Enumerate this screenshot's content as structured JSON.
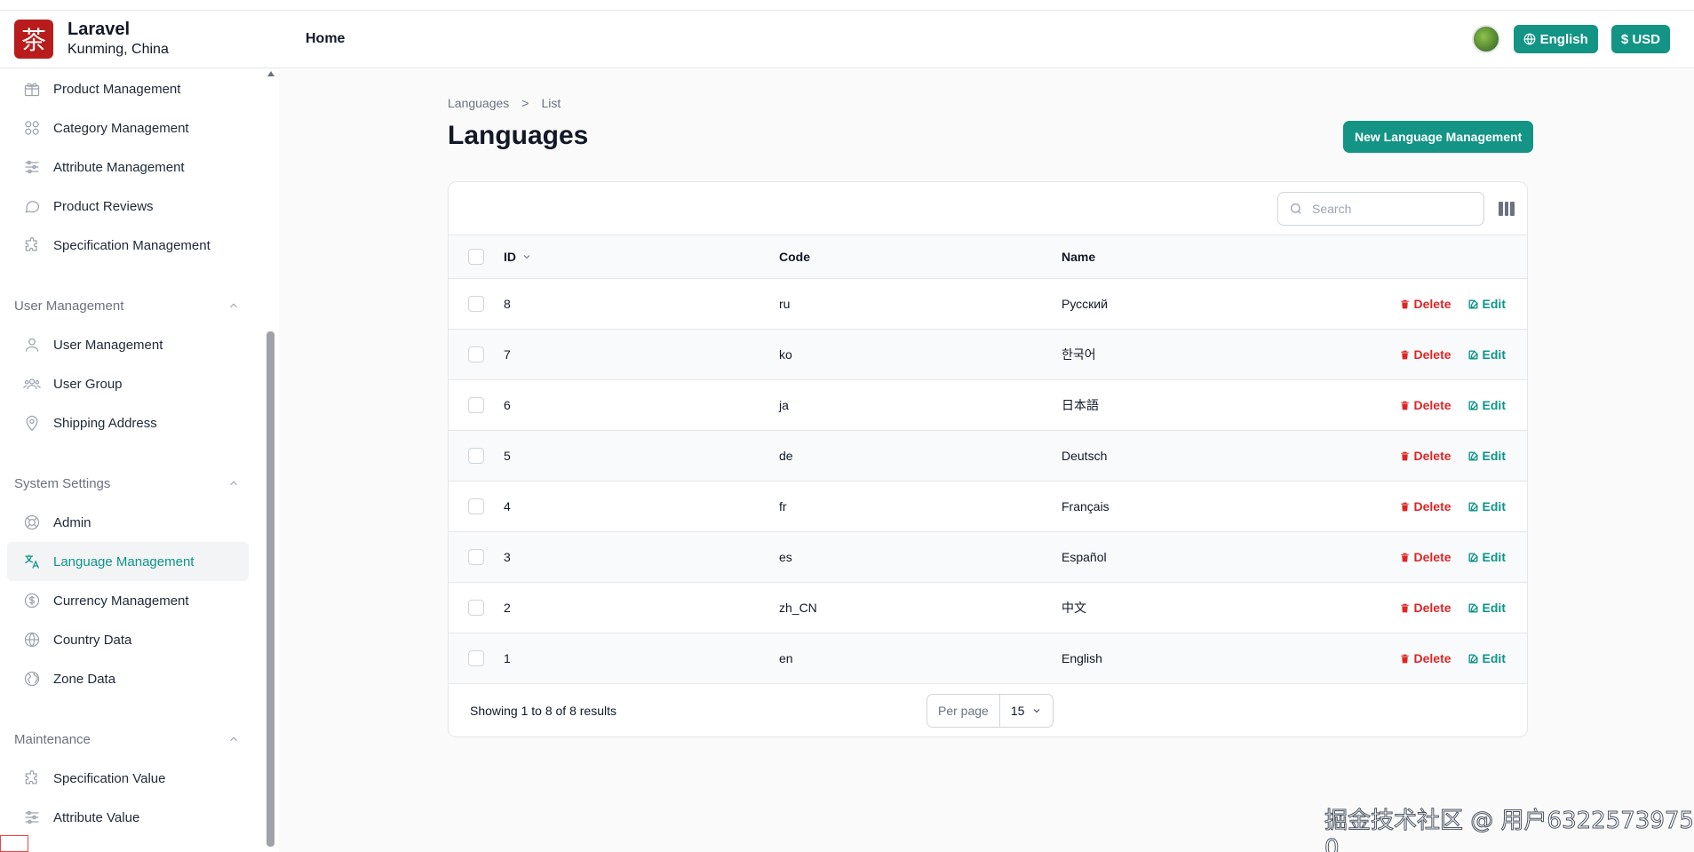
{
  "header": {
    "logo_char": "茶",
    "app_name": "Laravel",
    "location": "Kunming, China",
    "nav_home": "Home",
    "lang_button": "English",
    "currency_button": "$ USD"
  },
  "sidebar": {
    "top_items": [
      {
        "label": "Product Management",
        "icon": "gift-icon"
      },
      {
        "label": "Category Management",
        "icon": "grid-icon"
      },
      {
        "label": "Attribute Management",
        "icon": "sliders-icon"
      },
      {
        "label": "Product Reviews",
        "icon": "chat-bubble-icon"
      },
      {
        "label": "Specification Management",
        "icon": "puzzle-icon"
      }
    ],
    "groups": [
      {
        "label": "User Management",
        "items": [
          {
            "label": "User Management",
            "icon": "user-icon"
          },
          {
            "label": "User Group",
            "icon": "users-icon"
          },
          {
            "label": "Shipping Address",
            "icon": "map-pin-icon"
          }
        ]
      },
      {
        "label": "System Settings",
        "items": [
          {
            "label": "Admin",
            "icon": "lifebuoy-icon"
          },
          {
            "label": "Language Management",
            "icon": "translate-icon",
            "active": true
          },
          {
            "label": "Currency Management",
            "icon": "dollar-circle-icon"
          },
          {
            "label": "Country Data",
            "icon": "globe-icon"
          },
          {
            "label": "Zone Data",
            "icon": "globe-alt-icon"
          }
        ]
      },
      {
        "label": "Maintenance",
        "items": [
          {
            "label": "Specification Value",
            "icon": "puzzle-icon"
          },
          {
            "label": "Attribute Value",
            "icon": "sliders-icon"
          }
        ]
      }
    ]
  },
  "breadcrumb": {
    "parent": "Languages",
    "separator": ">",
    "current": "List"
  },
  "page": {
    "title": "Languages",
    "new_button": "New Language Management"
  },
  "table": {
    "search_placeholder": "Search",
    "columns": {
      "id": "ID",
      "code": "Code",
      "name": "Name"
    },
    "delete_label": "Delete",
    "edit_label": "Edit",
    "rows": [
      {
        "id": "8",
        "code": "ru",
        "name": "Русский"
      },
      {
        "id": "7",
        "code": "ko",
        "name": "한국어"
      },
      {
        "id": "6",
        "code": "ja",
        "name": "日本語"
      },
      {
        "id": "5",
        "code": "de",
        "name": "Deutsch"
      },
      {
        "id": "4",
        "code": "fr",
        "name": "Français"
      },
      {
        "id": "3",
        "code": "es",
        "name": "Español"
      },
      {
        "id": "2",
        "code": "zh_CN",
        "name": "中文"
      },
      {
        "id": "1",
        "code": "en",
        "name": "English"
      }
    ],
    "summary": "Showing 1 to 8 of 8 results",
    "per_page_label": "Per page",
    "per_page_value": "15"
  },
  "watermark": "掘金技术社区 @ 用户6322573975​0",
  "colors": {
    "accent": "#139485",
    "danger": "#dc2626",
    "logo": "#b91c1c"
  }
}
